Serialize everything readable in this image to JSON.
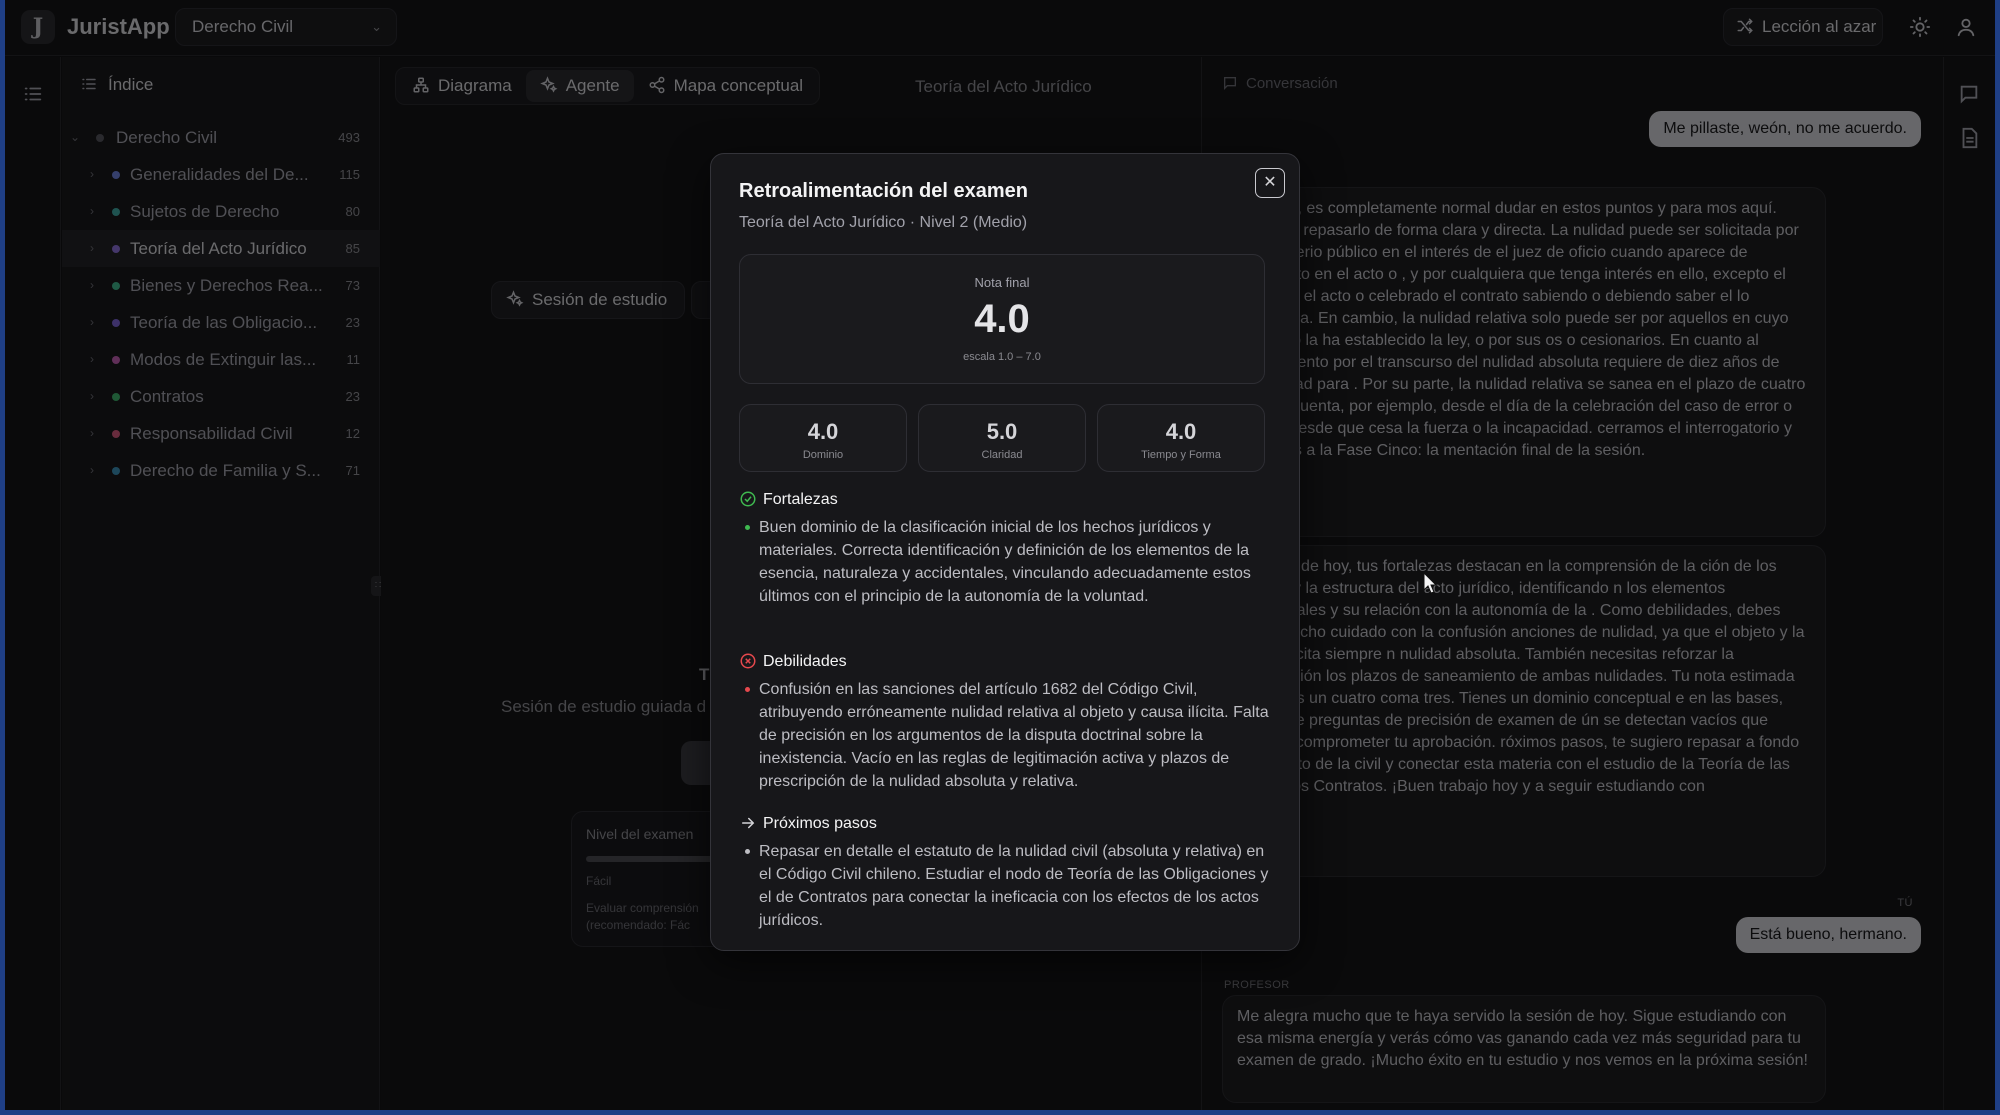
{
  "app": {
    "title": "JuristApp",
    "logo_letter": "J",
    "subject": "Derecho Civil",
    "random_lesson": "Lección al azar"
  },
  "sidebar": {
    "title": "Índice",
    "root": {
      "label": "Derecho Civil",
      "count": "493"
    },
    "items": [
      {
        "label": "Generalidades del De...",
        "count": "115",
        "color": "#6b7fd6"
      },
      {
        "label": "Sujetos de Derecho",
        "count": "80",
        "color": "#3fa7a0"
      },
      {
        "label": "Teoría del Acto Jurídico",
        "count": "85",
        "color": "#8b6fd6"
      },
      {
        "label": "Bienes y Derechos Rea...",
        "count": "73",
        "color": "#3fb58a"
      },
      {
        "label": "Teoría de las Obligacio...",
        "count": "23",
        "color": "#7a62d0"
      },
      {
        "label": "Modos de Extinguir las...",
        "count": "11",
        "color": "#c05fb0"
      },
      {
        "label": "Contratos",
        "count": "23",
        "color": "#3fb06a"
      },
      {
        "label": "Responsabilidad Civil",
        "count": "12",
        "color": "#d0587a"
      },
      {
        "label": "Derecho de Familia y S...",
        "count": "71",
        "color": "#3a8fb5"
      }
    ]
  },
  "center": {
    "tabs": [
      "Diagrama",
      "Agente",
      "Mapa conceptual"
    ],
    "active_tab": "Agente",
    "title": "Teoría del Acto Jurídico",
    "study_button": "Sesión de estudio",
    "heading_fragment": "T",
    "subtitle_fragment": "Sesión de estudio guiada d",
    "level_card": {
      "label": "Nivel del examen",
      "level": "Fácil",
      "desc": "Evaluar comprensión",
      "recommended": "(recomendado: Fác"
    }
  },
  "chat": {
    "header": "Conversación",
    "msg1": "Me pillaste, weón, no me acuerdo.",
    "bot1": "eocupes, es completamente normal dudar en estos puntos y para mos aquí. Vamos a repasarlo de forma clara y directa. La nulidad puede ser solicitada por el ministerio público en el interés de el juez de oficio cuando aparece de manifiesto en el acto o , y por cualquiera que tenga interés en ello, excepto el que ha o el acto o celebrado el contrato sabiendo o debiendo saber el lo invalidaba. En cambio, la nulidad relativa solo puede ser por aquellos en cuyo beneficio la ha establecido la ley, o por sus os o cesionarios. En cuanto al saneamiento por el transcurso del nulidad absoluta requiere de diez años de inactividad para . Por su parte, la nulidad relativa se sanea en el plazo de cuatro cual se cuenta, por ejemplo, desde el día de la celebración del caso de error o dolo, o desde que cesa la fuerza o la incapacidad. cerramos el interrogatorio y pasamos a la Fase Cinco: la mentación final de la sesión.",
    "bot2": "aluación de hoy, tus fortalezas destacan en la comprensión de la ción de los hechos y la estructura del acto jurídico, identificando n los elementos accidentales y su relación con la autonomía de la . Como debilidades, debes tener mucho cuidado con la confusión anciones de nulidad, ya que el objeto y la causa ilícita siempre n nulidad absoluta. También necesitas reforzar la legitimación los plazos de saneamiento de ambas nulidades. Tu nota estimada sesión es un cuatro coma tres. Tienes un dominio conceptual e en las bases, pero ante preguntas de precisión de examen de ún se detectan vacíos que podrían comprometer tu aprobación. róximos pasos, te sugiero repasar a fondo el estatuto de la civil y conectar esta materia con el estudio de la Teoría de las ones y los Contratos. ¡Buen trabajo hoy y a seguir estudiando con",
    "you_label": "TÚ",
    "msg2": "Está bueno, hermano.",
    "prof_label": "PROFESOR",
    "bot3": "Me alegra mucho que te haya servido la sesión de hoy. Sigue estudiando con esa misma energía y verás cómo vas ganando cada vez más seguridad para tu examen de grado. ¡Mucho éxito en tu estudio y nos vemos en la próxima sesión!"
  },
  "modal": {
    "title": "Retroalimentación del examen",
    "subtitle": "Teoría del Acto Jurídico · Nivel 2 (Medio)",
    "grade_label": "Nota final",
    "grade_value": "4.0",
    "grade_scale": "escala 1.0 – 7.0",
    "scores": [
      {
        "value": "4.0",
        "label": "Dominio"
      },
      {
        "value": "5.0",
        "label": "Claridad"
      },
      {
        "value": "4.0",
        "label": "Tiempo y Forma"
      }
    ],
    "strengths_title": "Fortalezas",
    "strengths_text": "Buen dominio de la clasificación inicial de los hechos jurídicos y materiales. Correcta identificación y definición de los elementos de la esencia, naturaleza y accidentales, vinculando adecuadamente estos últimos con el principio de la autonomía de la voluntad.",
    "weaknesses_title": "Debilidades",
    "weaknesses_text": "Confusión en las sanciones del artículo 1682 del Código Civil, atribuyendo erróneamente nulidad relativa al objeto y causa ilícita. Falta de precisión en los argumentos de la disputa doctrinal sobre la inexistencia. Vacío en las reglas de legitimación activa y plazos de prescripción de la nulidad absoluta y relativa.",
    "next_title": "Próximos pasos",
    "next_text": "Repasar en detalle el estatuto de la nulidad civil (absoluta y relativa) en el Código Civil chileno. Estudiar el nodo de Teoría de las Obligaciones y el de Contratos para conectar la ineficacia con los efectos de los actos jurídicos."
  },
  "colors": {
    "accent_green": "#3fb950",
    "accent_red": "#e5484d",
    "frame_blue": "#1f3f86"
  }
}
